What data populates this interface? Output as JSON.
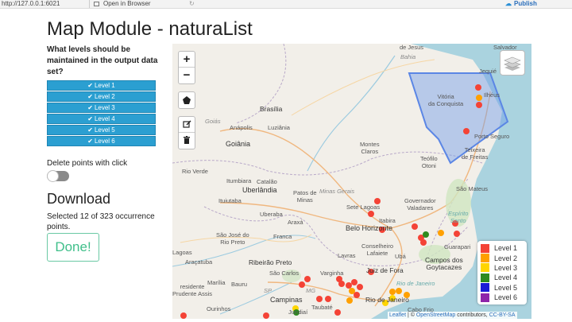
{
  "topbar": {
    "url": "http://127.0.0.1:6021",
    "open_in_browser": "Open in Browser",
    "publish": "Publish"
  },
  "page": {
    "title": "Map Module - naturaList"
  },
  "sidebar": {
    "question": "What levels should be maintained in the output data set?",
    "levels": [
      "Level 1",
      "Level 2",
      "Level 3",
      "Level 4",
      "Level 5",
      "Level 6"
    ],
    "check_icon": "check-icon"
  },
  "delete_points": {
    "label": "Delete points with click",
    "enabled": false
  },
  "download": {
    "title": "Download",
    "selected_text": "Selected 12 of 323 occurrence points.",
    "done_label": "Done!"
  },
  "map": {
    "zoom_in": "+",
    "zoom_out": "−",
    "polygon_icon": "pentagon-icon",
    "edit_icon": "edit-icon",
    "delete_icon": "trash-icon",
    "layers_icon": "layers-icon",
    "places": {
      "salvador": "Salvador",
      "jesus": "de Jesus",
      "bahia": "Bahia",
      "jequie": "Jequié",
      "ilheus": "Ilhéus",
      "vitoria": "Vitória\nda Conquista",
      "brasilia": "Brasília",
      "goias": "Goiás",
      "anapolis": "Anápolis",
      "luziania": "Luziânia",
      "goiania": "Goiânia",
      "montes_claros": "Montes\nClaros",
      "porto_seguro": "Porto Seguro",
      "teixeira": "Teixeira\nde Freitas",
      "teofilo": "Teófilo\nOtoni",
      "rio_verde": "Rio Verde",
      "itumbiara": "Itumbiara",
      "catalao": "Catalão",
      "uberlandia": "Uberlândia",
      "patos": "Patos de\nMinas",
      "minas_gerais": "Minas Gerais",
      "sao_mateus": "São Mateus",
      "ituiutaba": "Ituiutaba",
      "sete_lagoas": "Sete Lagoas",
      "governador": "Governador\nValadares",
      "espirito": "Espírito\nSanto",
      "uberaba": "Uberaba",
      "araxa": "Araxá",
      "itabira": "Itabira",
      "belo_horizonte": "Belo Horizonte",
      "sao_jose": "São José do\nRio Preto",
      "franca": "Franca",
      "conselheiro": "Conselheiro\nLafaiete",
      "lavras": "Lavras",
      "uba": "Ubá",
      "guarapari": "Guarapari",
      "lagoas": "Lagoas",
      "aracatuba": "Araçatuba",
      "ribeirao": "Ribeirão Preto",
      "sao_carlos": "São Carlos",
      "varginha": "Varginha",
      "juiz": "Juiz de Fora",
      "campos": "Campos dos\nGoytacazes",
      "marilia": "Marília",
      "bauru": "Bauru",
      "presidente": "residente\nPrudente Assis",
      "campinas": "Campinas",
      "rio_janeiro_state": "Rio de Janeiro",
      "rio": "Rio de Janeiro",
      "ourinhos": "Ourinhos",
      "jundiai": "Jundiaí",
      "taubate": "Taubaté",
      "cabo_frio": "Cabo Frio",
      "sp": "SP",
      "mg": "MG"
    },
    "legend": [
      {
        "label": "Level 1",
        "color": "#f44336"
      },
      {
        "label": "Level 2",
        "color": "#ffa000"
      },
      {
        "label": "Level 3",
        "color": "#ffd500"
      },
      {
        "label": "Level 4",
        "color": "#2e8b1f"
      },
      {
        "label": "Level 5",
        "color": "#1a1ad6"
      },
      {
        "label": "Level 6",
        "color": "#8e24aa"
      }
    ],
    "attribution": {
      "leaflet": "Leaflet",
      "sep": " | © ",
      "osm": "OpenStreetMap",
      "contributors": " contributors, ",
      "license": "CC-BY-SA"
    }
  },
  "colors": {
    "level_button": "#2b9fd1",
    "done_button": "#3fbf8a",
    "polygon_fill": "#6f9be8"
  }
}
